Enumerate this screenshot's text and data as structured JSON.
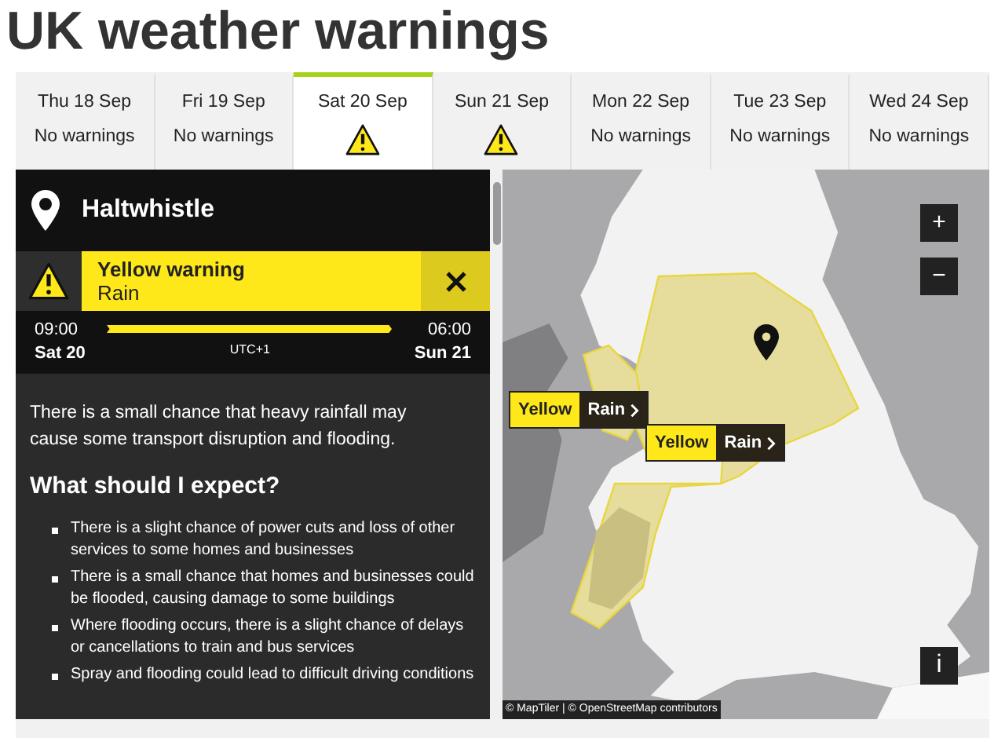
{
  "title": "UK weather warnings",
  "days": [
    {
      "day": "Thu 18 Sep",
      "kind": "none",
      "status": "No warnings",
      "selected": false
    },
    {
      "day": "Fri 19 Sep",
      "kind": "none",
      "status": "No warnings",
      "selected": false
    },
    {
      "day": "Sat 20 Sep",
      "kind": "warning",
      "selected": true
    },
    {
      "day": "Sun 21 Sep",
      "kind": "warning",
      "selected": false
    },
    {
      "day": "Mon 22 Sep",
      "kind": "none",
      "status": "No warnings",
      "selected": false
    },
    {
      "day": "Tue 23 Sep",
      "kind": "none",
      "status": "No warnings",
      "selected": false
    },
    {
      "day": "Wed 24 Sep",
      "kind": "none",
      "status": "No warnings",
      "selected": false
    }
  ],
  "location": "Haltwhistle",
  "warning": {
    "level": "Yellow warning",
    "type": "Rain",
    "color": "#ffe81a"
  },
  "timeline": {
    "start_time": "09:00",
    "start_day": "Sat 20",
    "timezone": "UTC+1",
    "end_time": "06:00",
    "end_day": "Sun 21"
  },
  "summary": "There is a small chance that heavy rainfall may cause some transport disruption and flooding.",
  "heading": "What should I expect?",
  "bullets": [
    "There is a slight chance of power cuts and loss of other services to some homes and businesses",
    "There is a small chance that homes and businesses could be flooded, causing damage to some buildings",
    "Where flooding occurs, there is a slight chance of delays or cancellations to train and bus services",
    "Spray and flooding could lead to difficult driving conditions"
  ],
  "map": {
    "kind": "picture",
    "labels": [
      {
        "level": "Yellow",
        "type": "Rain",
        "color": "#ffe81a"
      },
      {
        "level": "Yellow",
        "type": "Rain",
        "color": "#ffe81a"
      }
    ],
    "zoom_in": "+",
    "zoom_out": "−",
    "info": "i",
    "attribution": "© MapTiler | © OpenStreetMap contributors"
  }
}
